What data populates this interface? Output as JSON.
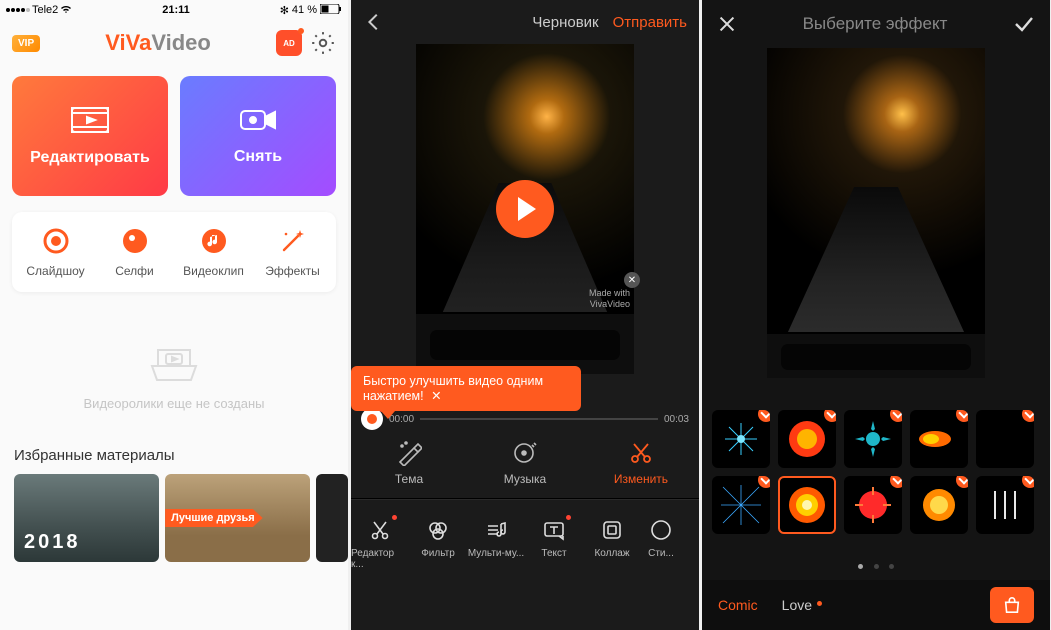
{
  "status": {
    "carrier": "Tele2",
    "time": "21:11",
    "battery": "41 %",
    "bt": "✻"
  },
  "home": {
    "vip": "VIP",
    "brand_viva": "ViVa",
    "brand_video": "Video",
    "ad": "AD",
    "edit_label": "Редактировать",
    "shoot_label": "Снять",
    "tools": {
      "slideshow": "Слайдшоу",
      "selfie": "Селфи",
      "clip": "Видеоклип",
      "effects": "Эффекты"
    },
    "empty": "Видеоролики еще не созданы",
    "section": "Избранные материалы",
    "materials": {
      "m1": "2018",
      "m2_tag": "Лучшие друзья"
    }
  },
  "editor": {
    "draft": "Черновик",
    "send": "Отправить",
    "watermark_a": "Made with",
    "watermark_b": "VivaVideo",
    "tip": "Быстро улучшить видео одним нажатием!",
    "tip_close": "✕",
    "time_start": "00:00",
    "time_end": "00:03",
    "tabs": {
      "theme": "Тема",
      "music": "Музыка",
      "edit": "Изменить"
    },
    "tools": {
      "t1": "Редактор к...",
      "t2": "Фильтр",
      "t3": "Мульти-му...",
      "t4": "Текст",
      "t5": "Коллаж",
      "t6": "Сти..."
    }
  },
  "fx": {
    "title": "Выберите эффект",
    "cat1": "Comic",
    "cat2": "Love"
  }
}
